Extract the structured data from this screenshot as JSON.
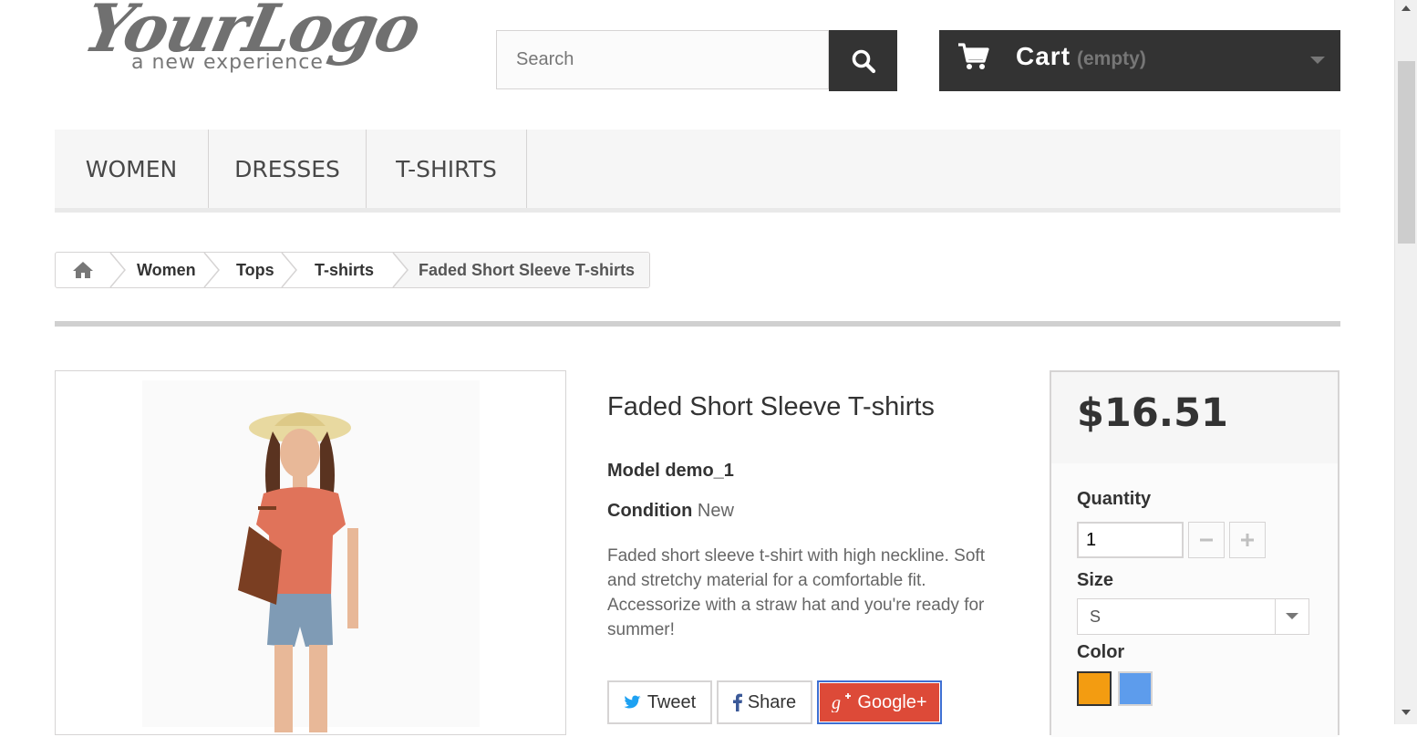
{
  "logo": {
    "script": "YourLogo",
    "tagline": "a new experience"
  },
  "search": {
    "placeholder": "Search"
  },
  "cart": {
    "label": "Cart",
    "status": "(empty)"
  },
  "menu": {
    "items": [
      "Women",
      "Dresses",
      "T-shirts"
    ]
  },
  "breadcrumb": {
    "items": [
      "Women",
      "Tops",
      "T-shirts",
      "Faded Short Sleeve T-shirts"
    ]
  },
  "product": {
    "title": "Faded Short Sleeve T-shirts",
    "model_label": "Model",
    "model_value": "demo_1",
    "condition_label": "Condition",
    "condition_value": "New",
    "description": "Faded short sleeve t-shirt with high neckline. Soft and stretchy material for a comfortable fit. Accessorize with a straw hat and you're ready for summer!"
  },
  "social": {
    "tweet": "Tweet",
    "share": "Share",
    "google": "Google+"
  },
  "buy_box": {
    "price": "$16.51",
    "quantity_label": "Quantity",
    "quantity_value": "1",
    "size_label": "Size",
    "size_value": "S",
    "color_label": "Color",
    "colors": [
      "#f39c11",
      "#5d9cec"
    ]
  },
  "icons": [
    "search-icon",
    "shopping-cart-icon",
    "chevron-down-icon",
    "home-icon",
    "minus-icon",
    "plus-icon",
    "twitter-icon",
    "facebook-icon",
    "google-plus-icon"
  ]
}
